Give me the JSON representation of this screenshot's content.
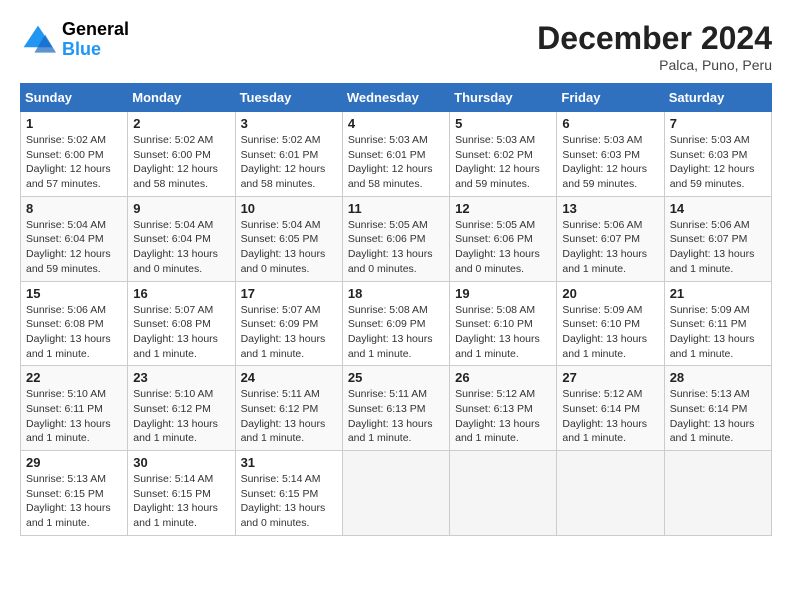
{
  "header": {
    "logo_general": "General",
    "logo_blue": "Blue",
    "month_year": "December 2024",
    "location": "Palca, Puno, Peru"
  },
  "calendar": {
    "days_of_week": [
      "Sunday",
      "Monday",
      "Tuesday",
      "Wednesday",
      "Thursday",
      "Friday",
      "Saturday"
    ],
    "weeks": [
      [
        {
          "day": "1",
          "info": "Sunrise: 5:02 AM\nSunset: 6:00 PM\nDaylight: 12 hours\nand 57 minutes."
        },
        {
          "day": "2",
          "info": "Sunrise: 5:02 AM\nSunset: 6:00 PM\nDaylight: 12 hours\nand 58 minutes."
        },
        {
          "day": "3",
          "info": "Sunrise: 5:02 AM\nSunset: 6:01 PM\nDaylight: 12 hours\nand 58 minutes."
        },
        {
          "day": "4",
          "info": "Sunrise: 5:03 AM\nSunset: 6:01 PM\nDaylight: 12 hours\nand 58 minutes."
        },
        {
          "day": "5",
          "info": "Sunrise: 5:03 AM\nSunset: 6:02 PM\nDaylight: 12 hours\nand 59 minutes."
        },
        {
          "day": "6",
          "info": "Sunrise: 5:03 AM\nSunset: 6:03 PM\nDaylight: 12 hours\nand 59 minutes."
        },
        {
          "day": "7",
          "info": "Sunrise: 5:03 AM\nSunset: 6:03 PM\nDaylight: 12 hours\nand 59 minutes."
        }
      ],
      [
        {
          "day": "8",
          "info": "Sunrise: 5:04 AM\nSunset: 6:04 PM\nDaylight: 12 hours\nand 59 minutes."
        },
        {
          "day": "9",
          "info": "Sunrise: 5:04 AM\nSunset: 6:04 PM\nDaylight: 13 hours\nand 0 minutes."
        },
        {
          "day": "10",
          "info": "Sunrise: 5:04 AM\nSunset: 6:05 PM\nDaylight: 13 hours\nand 0 minutes."
        },
        {
          "day": "11",
          "info": "Sunrise: 5:05 AM\nSunset: 6:06 PM\nDaylight: 13 hours\nand 0 minutes."
        },
        {
          "day": "12",
          "info": "Sunrise: 5:05 AM\nSunset: 6:06 PM\nDaylight: 13 hours\nand 0 minutes."
        },
        {
          "day": "13",
          "info": "Sunrise: 5:06 AM\nSunset: 6:07 PM\nDaylight: 13 hours\nand 1 minute."
        },
        {
          "day": "14",
          "info": "Sunrise: 5:06 AM\nSunset: 6:07 PM\nDaylight: 13 hours\nand 1 minute."
        }
      ],
      [
        {
          "day": "15",
          "info": "Sunrise: 5:06 AM\nSunset: 6:08 PM\nDaylight: 13 hours\nand 1 minute."
        },
        {
          "day": "16",
          "info": "Sunrise: 5:07 AM\nSunset: 6:08 PM\nDaylight: 13 hours\nand 1 minute."
        },
        {
          "day": "17",
          "info": "Sunrise: 5:07 AM\nSunset: 6:09 PM\nDaylight: 13 hours\nand 1 minute."
        },
        {
          "day": "18",
          "info": "Sunrise: 5:08 AM\nSunset: 6:09 PM\nDaylight: 13 hours\nand 1 minute."
        },
        {
          "day": "19",
          "info": "Sunrise: 5:08 AM\nSunset: 6:10 PM\nDaylight: 13 hours\nand 1 minute."
        },
        {
          "day": "20",
          "info": "Sunrise: 5:09 AM\nSunset: 6:10 PM\nDaylight: 13 hours\nand 1 minute."
        },
        {
          "day": "21",
          "info": "Sunrise: 5:09 AM\nSunset: 6:11 PM\nDaylight: 13 hours\nand 1 minute."
        }
      ],
      [
        {
          "day": "22",
          "info": "Sunrise: 5:10 AM\nSunset: 6:11 PM\nDaylight: 13 hours\nand 1 minute."
        },
        {
          "day": "23",
          "info": "Sunrise: 5:10 AM\nSunset: 6:12 PM\nDaylight: 13 hours\nand 1 minute."
        },
        {
          "day": "24",
          "info": "Sunrise: 5:11 AM\nSunset: 6:12 PM\nDaylight: 13 hours\nand 1 minute."
        },
        {
          "day": "25",
          "info": "Sunrise: 5:11 AM\nSunset: 6:13 PM\nDaylight: 13 hours\nand 1 minute."
        },
        {
          "day": "26",
          "info": "Sunrise: 5:12 AM\nSunset: 6:13 PM\nDaylight: 13 hours\nand 1 minute."
        },
        {
          "day": "27",
          "info": "Sunrise: 5:12 AM\nSunset: 6:14 PM\nDaylight: 13 hours\nand 1 minute."
        },
        {
          "day": "28",
          "info": "Sunrise: 5:13 AM\nSunset: 6:14 PM\nDaylight: 13 hours\nand 1 minute."
        }
      ],
      [
        {
          "day": "29",
          "info": "Sunrise: 5:13 AM\nSunset: 6:15 PM\nDaylight: 13 hours\nand 1 minute."
        },
        {
          "day": "30",
          "info": "Sunrise: 5:14 AM\nSunset: 6:15 PM\nDaylight: 13 hours\nand 1 minute."
        },
        {
          "day": "31",
          "info": "Sunrise: 5:14 AM\nSunset: 6:15 PM\nDaylight: 13 hours\nand 0 minutes."
        },
        {
          "day": "",
          "info": ""
        },
        {
          "day": "",
          "info": ""
        },
        {
          "day": "",
          "info": ""
        },
        {
          "day": "",
          "info": ""
        }
      ]
    ]
  }
}
